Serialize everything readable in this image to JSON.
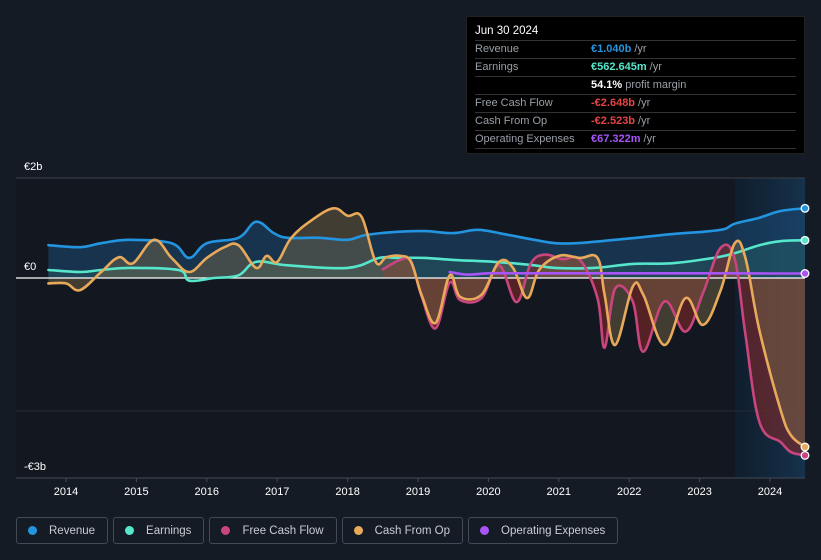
{
  "tooltip": {
    "date": "Jun 30 2024",
    "rows": [
      {
        "label": "Revenue",
        "value": "€1.040b",
        "unit": "/yr",
        "color": "#2394df"
      },
      {
        "label": "Earnings",
        "value": "€562.645m",
        "unit": "/yr",
        "color": "#55e6cb"
      },
      {
        "label": "",
        "value": "54.1%",
        "unit": "profit margin",
        "color": "#ffffff"
      },
      {
        "label": "Free Cash Flow",
        "value": "-€2.648b",
        "unit": "/yr",
        "color": "#e64545"
      },
      {
        "label": "Cash From Op",
        "value": "-€2.523b",
        "unit": "/yr",
        "color": "#e64545"
      },
      {
        "label": "Operating Expenses",
        "value": "€67.322m",
        "unit": "/yr",
        "color": "#a855f7"
      }
    ]
  },
  "legend": [
    {
      "label": "Revenue",
      "color": "#2394df"
    },
    {
      "label": "Earnings",
      "color": "#55e6cb"
    },
    {
      "label": "Free Cash Flow",
      "color": "#c8457e"
    },
    {
      "label": "Cash From Op",
      "color": "#e8aa5a"
    },
    {
      "label": "Operating Expenses",
      "color": "#a855f7"
    }
  ],
  "chart_data": {
    "type": "line",
    "title": "",
    "xlabel": "",
    "ylabel": "",
    "y_tick_labels": [
      "€2b",
      "€0",
      "-€3b"
    ],
    "x_tick_labels": [
      "2014",
      "2015",
      "2016",
      "2017",
      "2018",
      "2019",
      "2020",
      "2021",
      "2022",
      "2023",
      "2024"
    ],
    "x_range": [
      2013.75,
      2024.5
    ],
    "y_range_billions": [
      -3,
      2
    ],
    "highlight_from": 2023.5,
    "grid": true,
    "legend_position": "bottom",
    "series": [
      {
        "name": "Revenue",
        "color": "#2394df",
        "fill": true,
        "x": [
          2013.75,
          2014.2,
          2014.5,
          2014.9,
          2015.5,
          2015.75,
          2016.0,
          2016.45,
          2016.7,
          2016.95,
          2017.15,
          2017.6,
          2018.0,
          2018.25,
          2018.7,
          2019.1,
          2019.5,
          2019.85,
          2020.2,
          2020.65,
          2020.95,
          2021.25,
          2021.8,
          2022.2,
          2022.65,
          2023.05,
          2023.35,
          2023.5,
          2023.85,
          2024.15,
          2024.5
        ],
        "values": [
          0.49,
          0.46,
          0.52,
          0.57,
          0.52,
          0.3,
          0.52,
          0.6,
          0.84,
          0.67,
          0.6,
          0.6,
          0.57,
          0.64,
          0.69,
          0.7,
          0.67,
          0.72,
          0.66,
          0.57,
          0.52,
          0.52,
          0.57,
          0.61,
          0.66,
          0.69,
          0.73,
          0.81,
          0.9,
          1.0,
          1.04
        ]
      },
      {
        "name": "Earnings",
        "color": "#55e6cb",
        "fill": true,
        "x": [
          2013.75,
          2014.2,
          2014.5,
          2014.9,
          2015.6,
          2015.75,
          2016.1,
          2016.45,
          2016.7,
          2017.15,
          2018.0,
          2018.45,
          2018.7,
          2019.1,
          2019.5,
          2020.1,
          2020.65,
          2020.95,
          2021.5,
          2022.05,
          2022.6,
          2023.2,
          2023.5,
          2023.85,
          2024.15,
          2024.5
        ],
        "values": [
          0.12,
          0.09,
          0.12,
          0.15,
          0.12,
          -0.04,
          0.0,
          0.04,
          0.24,
          0.19,
          0.15,
          0.3,
          0.3,
          0.3,
          0.27,
          0.24,
          0.19,
          0.15,
          0.15,
          0.21,
          0.22,
          0.3,
          0.37,
          0.49,
          0.55,
          0.563
        ]
      },
      {
        "name": "Free Cash Flow",
        "color": "#c8457e",
        "fill": true,
        "x": [
          2018.5,
          2018.75,
          2018.9,
          2019.05,
          2019.25,
          2019.45,
          2019.6,
          2019.9,
          2020.15,
          2020.4,
          2020.6,
          2020.8,
          2021.05,
          2021.3,
          2021.55,
          2021.65,
          2021.8,
          2022.05,
          2022.2,
          2022.5,
          2022.8,
          2023.05,
          2023.3,
          2023.5,
          2023.65,
          2023.85,
          2024.15,
          2024.3,
          2024.5
        ],
        "values": [
          0.13,
          0.27,
          0.25,
          -0.27,
          -0.75,
          -0.07,
          -0.33,
          -0.3,
          0.19,
          -0.36,
          0.21,
          0.35,
          0.28,
          0.27,
          -0.3,
          -1.04,
          -0.16,
          -0.35,
          -1.1,
          -0.35,
          -0.8,
          -0.22,
          0.45,
          0.28,
          -0.84,
          -2.15,
          -2.45,
          -2.6,
          -2.648
        ]
      },
      {
        "name": "Cash From Op",
        "color": "#e8aa5a",
        "fill": true,
        "x": [
          2013.75,
          2014.0,
          2014.2,
          2014.5,
          2014.75,
          2014.95,
          2015.25,
          2015.5,
          2015.75,
          2016.0,
          2016.25,
          2016.45,
          2016.7,
          2016.85,
          2017.0,
          2017.2,
          2017.5,
          2017.8,
          2018.0,
          2018.2,
          2018.4,
          2018.55,
          2018.75,
          2018.9,
          2019.05,
          2019.25,
          2019.45,
          2019.6,
          2019.9,
          2020.15,
          2020.35,
          2020.55,
          2020.72,
          2021.0,
          2021.3,
          2021.55,
          2021.65,
          2021.8,
          2022.05,
          2022.2,
          2022.5,
          2022.8,
          2023.05,
          2023.3,
          2023.5,
          2023.65,
          2023.85,
          2024.15,
          2024.3,
          2024.5
        ],
        "values": [
          -0.08,
          -0.08,
          -0.18,
          0.09,
          0.31,
          0.22,
          0.57,
          0.3,
          0.09,
          0.3,
          0.46,
          0.49,
          0.15,
          0.33,
          0.24,
          0.6,
          0.87,
          1.04,
          0.93,
          0.91,
          0.24,
          0.31,
          0.33,
          0.24,
          -0.25,
          -0.67,
          0.04,
          -0.28,
          -0.25,
          0.24,
          0.15,
          -0.3,
          0.12,
          0.33,
          0.3,
          0.3,
          -0.25,
          -1.0,
          -0.13,
          -0.25,
          -1.0,
          -0.3,
          -0.7,
          -0.18,
          0.52,
          0.3,
          -0.78,
          -1.97,
          -2.35,
          -2.523
        ]
      },
      {
        "name": "Operating Expenses",
        "color": "#a855f7",
        "fill": false,
        "x": [
          2019.45,
          2019.7,
          2020.0,
          2020.5,
          2021.0,
          2021.5,
          2022.0,
          2022.5,
          2023.0,
          2023.5,
          2024.0,
          2024.5
        ],
        "values": [
          0.09,
          0.05,
          0.07,
          0.07,
          0.07,
          0.07,
          0.07,
          0.07,
          0.07,
          0.07,
          0.067,
          0.067
        ]
      }
    ]
  }
}
